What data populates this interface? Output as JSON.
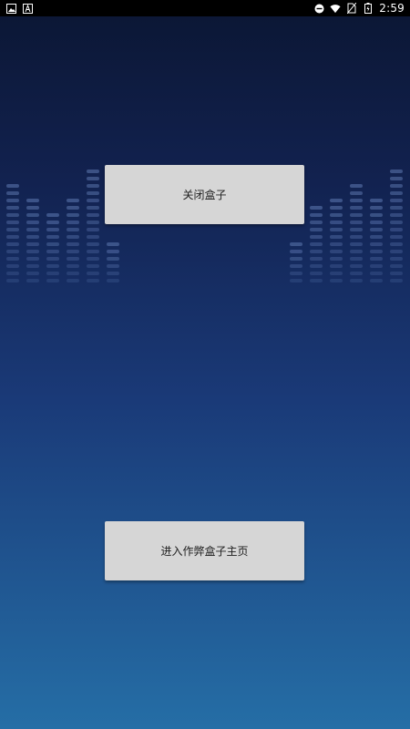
{
  "status_bar": {
    "time": "2:59",
    "left_icons": [
      "image-icon",
      "text-a-icon"
    ],
    "right_icons": [
      "dnd-minus-icon",
      "wifi-icon",
      "no-sim-icon",
      "battery-charging-icon"
    ]
  },
  "buttons": {
    "close_box": "关闭盒子",
    "enter_home": "进入作弊盒子主页"
  },
  "colors": {
    "bg_top": "#0b1633",
    "bg_bottom": "#256ea6",
    "button_bg": "#d6d6d6"
  }
}
